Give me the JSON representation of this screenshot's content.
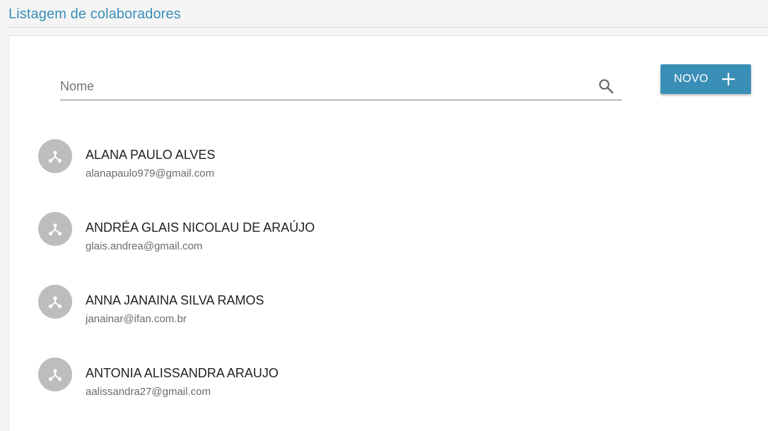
{
  "header": {
    "title": "Listagem de colaboradores"
  },
  "search": {
    "placeholder": "Nome",
    "value": "",
    "icon": "search-icon"
  },
  "new_button": {
    "label": "NOVO",
    "icon": "plus-icon"
  },
  "colors": {
    "accent": "#3a8fb7",
    "avatar": "#bdbdbd"
  },
  "collaborators": [
    {
      "name": "ALANA PAULO ALVES",
      "email": "alanapaulo979@gmail.com",
      "icon": "share-icon"
    },
    {
      "name": "ANDRÉA GLAIS NICOLAU DE ARAÚJO",
      "email": "glais.andrea@gmail.com",
      "icon": "share-icon"
    },
    {
      "name": "ANNA JANAINA SILVA RAMOS",
      "email": "janainar@ifan.com.br",
      "icon": "share-icon"
    },
    {
      "name": "ANTONIA ALISSANDRA ARAUJO",
      "email": "aalissandra27@gmail.com",
      "icon": "share-icon"
    }
  ]
}
